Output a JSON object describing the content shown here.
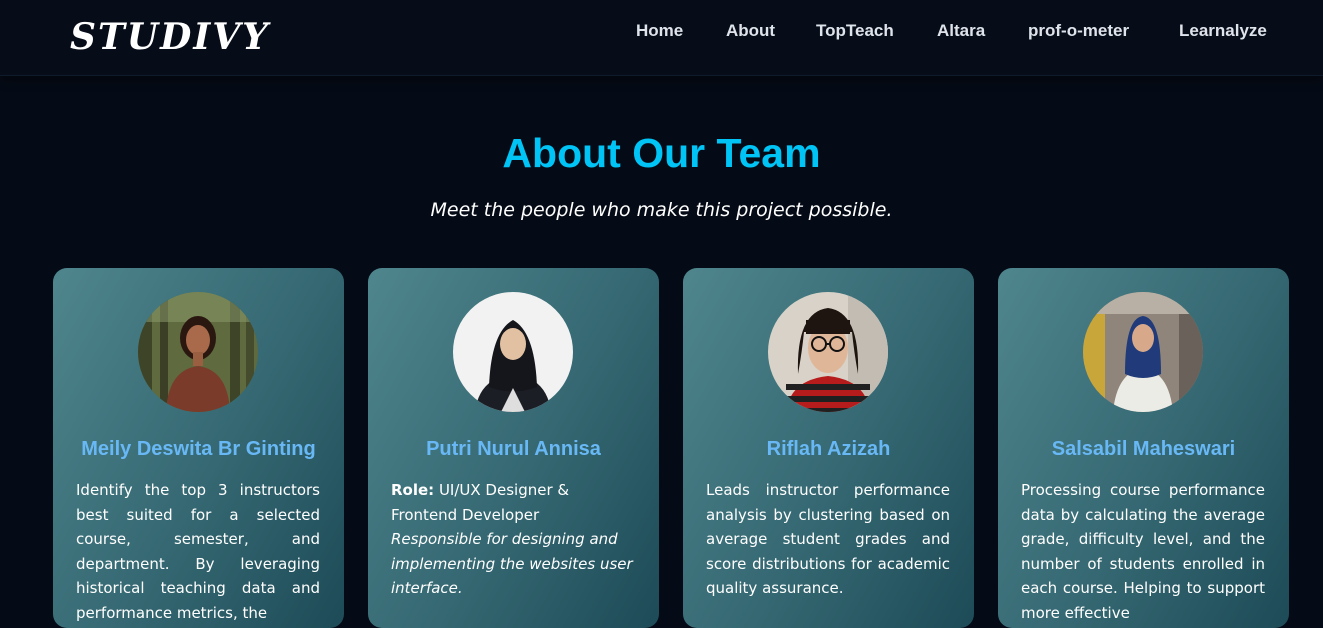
{
  "nav": {
    "logo": "STUDIVY",
    "links": [
      "Home",
      "About",
      "TopTeach",
      "Altara",
      "prof-o-meter",
      "Learnalyze"
    ]
  },
  "hero": {
    "title": "About Our Team",
    "subtitle": "Meet the people who make this project possible."
  },
  "team": [
    {
      "name": "Meily Deswita Br Ginting",
      "description": "Identify the top 3 instructors best suited for a selected course, semester, and department. By leveraging historical teaching data and performance metrics, the"
    },
    {
      "name": "Putri Nurul Annisa",
      "role_label": "Role:",
      "role": "UI/UX Designer & Frontend Developer",
      "description": "Responsible for designing and implementing the websites user interface."
    },
    {
      "name": "Riflah Azizah",
      "description": "Leads instructor performance analysis by clustering based on average student grades and score distributions for academic quality assurance."
    },
    {
      "name": "Salsabil Maheswari",
      "description": "Processing course performance data by calculating the average grade, difficulty level, and the number of students enrolled in each course. Helping to support more effective"
    }
  ],
  "colors": {
    "background": "#050b16",
    "accent": "#00c4f5",
    "name": "#69b8f6"
  }
}
